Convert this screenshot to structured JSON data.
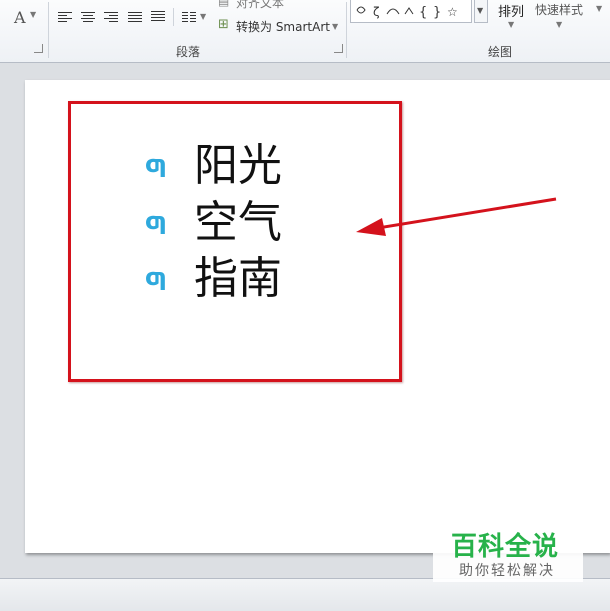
{
  "ribbon": {
    "font_color_letter": "A",
    "paragraph_group_label": "段落",
    "drawing_group_label": "绘图",
    "align_text_label": "对齐文本",
    "smartart_label": "转换为 SmartArt",
    "arrange_label": "排列",
    "quick_styles_label": "快速样式"
  },
  "slide": {
    "bullets": [
      {
        "symbol": "ƣ",
        "text": "阳光"
      },
      {
        "symbol": "ƣ",
        "text": "空气"
      },
      {
        "symbol": "ƣ",
        "text": "指南"
      }
    ]
  },
  "watermark": {
    "title": "百科全说",
    "subtitle": "助你轻松解决"
  },
  "colors": {
    "bullet": "#2ea9dd",
    "highlight_box": "#d4121c",
    "watermark_green": "#27b24a"
  }
}
